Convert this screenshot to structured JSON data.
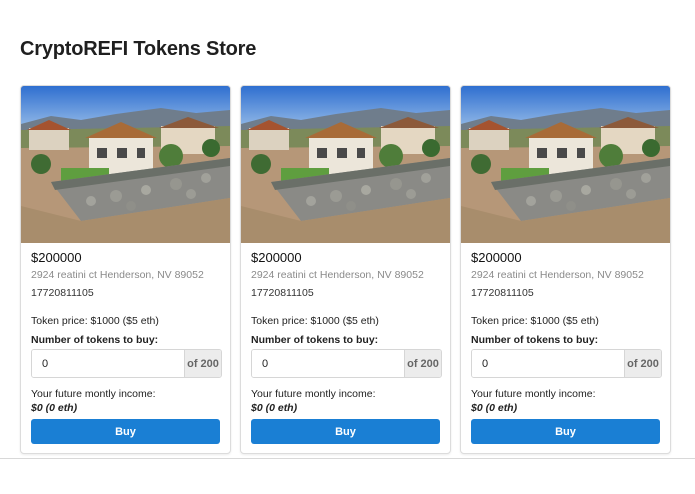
{
  "page": {
    "title": "CryptoREFI Tokens Store"
  },
  "cards": [
    {
      "price": "$200000",
      "address": "2924 reatini ct Henderson, NV 89052",
      "id": "17720811105",
      "token_price": "Token price: $1000 ($5 eth)",
      "qty_label": "Number of tokens to buy:",
      "qty_value": "0",
      "qty_suffix": "of 200",
      "income_label": "Your future montly income:",
      "income_value": "$0 (0 eth)",
      "buy_label": "Buy"
    },
    {
      "price": "$200000",
      "address": "2924 reatini ct Henderson, NV 89052",
      "id": "17720811105",
      "token_price": "Token price: $1000 ($5 eth)",
      "qty_label": "Number of tokens to buy:",
      "qty_value": "0",
      "qty_suffix": "of 200",
      "income_label": "Your future montly income:",
      "income_value": "$0 (0 eth)",
      "buy_label": "Buy"
    },
    {
      "price": "$200000",
      "address": "2924 reatini ct Henderson, NV 89052",
      "id": "17720811105",
      "token_price": "Token price: $1000 ($5 eth)",
      "qty_label": "Number of tokens to buy:",
      "qty_value": "0",
      "qty_suffix": "of 200",
      "income_label": "Your future montly income:",
      "income_value": "$0 (0 eth)",
      "buy_label": "Buy"
    }
  ],
  "colors": {
    "accent": "#1a7fd4",
    "suffix_bg": "#ececec",
    "muted_text": "#8a8a8a"
  }
}
